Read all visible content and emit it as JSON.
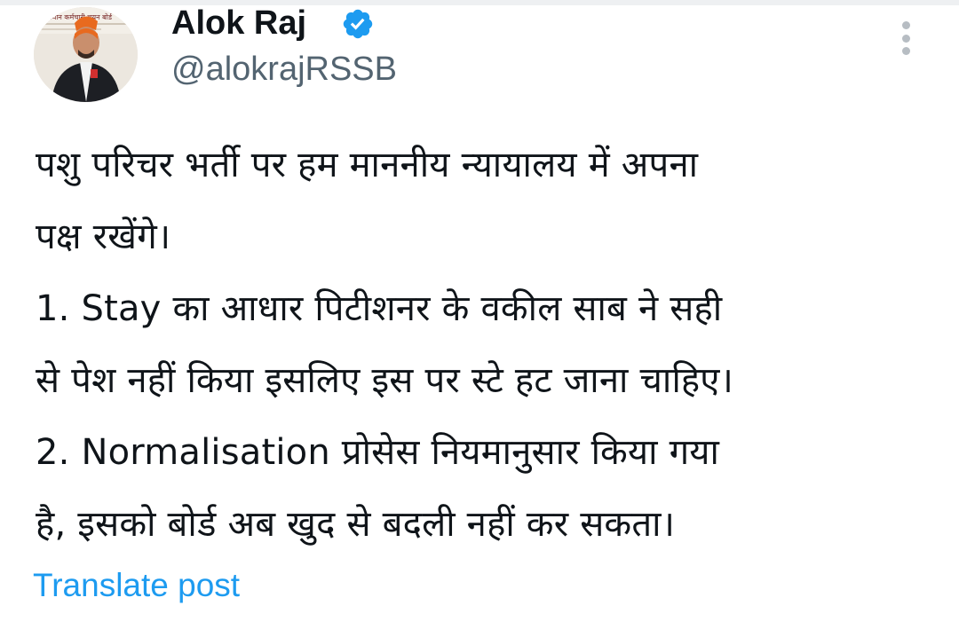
{
  "author": {
    "display_name": "Alok Raj",
    "handle": "@alokrajRSSB",
    "verified_icon": "verified-badge-icon",
    "avatar_icon": "profile-photo",
    "avatar_backdrop_text": "राजस्थान कर्मचारी चयन बोर्ड"
  },
  "menu": {
    "icon": "more-vertical-icon"
  },
  "tweet": {
    "lines": [
      "पशु परिचर भर्ती पर हम माननीय न्यायालय में अपना",
      "पक्ष रखेंगे।",
      "1. Stay का आधार पिटीशनर के वकील साब ने सही",
      "से पेश नहीं किया इसलिए इस पर स्टे हट जाना चाहिए।",
      "2. Normalisation प्रोसेस नियमानुसार किया गया",
      "है, इसको बोर्ड अब खुद से बदली नहीं कर सकता।"
    ]
  },
  "actions": {
    "translate_label": "Translate post"
  },
  "colors": {
    "text_primary": "#0f1419",
    "text_secondary": "#536471",
    "link": "#1d9bf0",
    "verified": "#1d9bf0"
  }
}
